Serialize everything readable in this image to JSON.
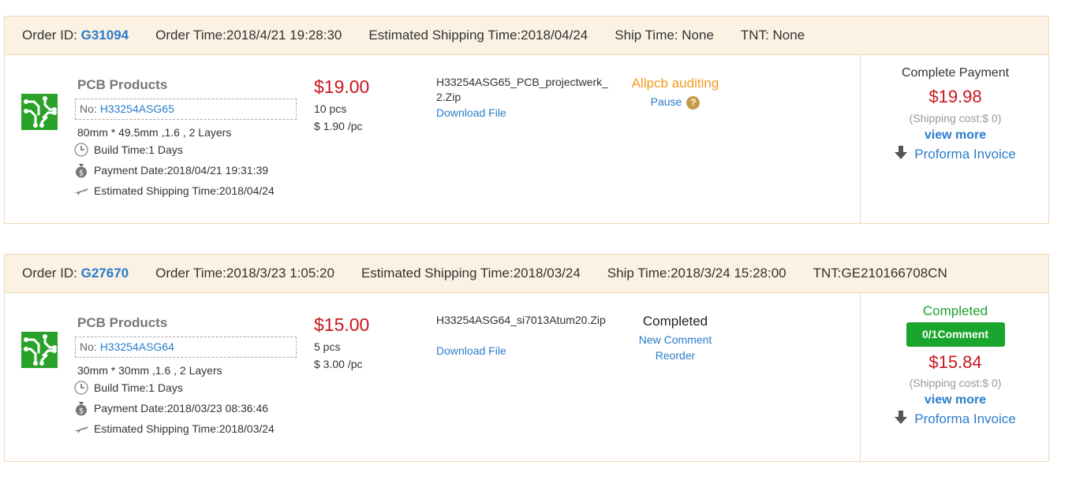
{
  "orders": [
    {
      "header": {
        "order_id_label": "Order ID: ",
        "order_id": "G31094",
        "order_time": "Order Time:2018/4/21 19:28:30",
        "est_shipping": "Estimated Shipping Time:2018/04/24",
        "ship_time": "Ship Time: None",
        "tnt": "TNT: None"
      },
      "product": {
        "title": "PCB Products",
        "no_label": "No: ",
        "no": "H33254ASG65",
        "spec": "80mm * 49.5mm ,1.6 , 2 Layers",
        "build_time": "Build Time:1 Days",
        "payment_date": "Payment Date:2018/04/21 19:31:39",
        "est_shipping": "Estimated Shipping Time:2018/04/24"
      },
      "price": "$19.00",
      "qty": "10 pcs",
      "unit_price": "$ 1.90 /pc",
      "file": {
        "name": "H33254ASG65_PCB_projectwerk_2.Zip",
        "download": "Download File"
      },
      "status": {
        "main": "Allpcb auditing",
        "main_color": "#f39a1e",
        "actions": [
          "Pause"
        ]
      },
      "payment": {
        "title": "Complete Payment",
        "amount": "$19.98",
        "shipping_cost": "(Shipping cost:$ 0)",
        "view_more": "view more",
        "invoice": "Proforma Invoice"
      }
    },
    {
      "header": {
        "order_id_label": "Order ID: ",
        "order_id": "G27670",
        "order_time": "Order Time:2018/3/23 1:05:20",
        "est_shipping": "Estimated Shipping Time:2018/03/24",
        "ship_time": "Ship Time:2018/3/24 15:28:00",
        "tnt": "TNT:GE210166708CN"
      },
      "product": {
        "title": "PCB Products",
        "no_label": "No: ",
        "no": "H33254ASG64",
        "spec": "30mm * 30mm ,1.6 , 2 Layers",
        "build_time": "Build Time:1 Days",
        "payment_date": "Payment Date:2018/03/23 08:36:46",
        "est_shipping": "Estimated Shipping Time:2018/03/24"
      },
      "price": "$15.00",
      "qty": "5 pcs",
      "unit_price": "$ 3.00 /pc",
      "file": {
        "name": "H33254ASG64_si7013Atum20.Zip",
        "download": "Download File"
      },
      "status": {
        "main": "Completed",
        "main_color": "#222222",
        "actions": [
          "New Comment",
          "Reorder"
        ]
      },
      "payment": {
        "title": "Completed",
        "comment_button": "0/1Comment",
        "amount": "$15.84",
        "shipping_cost": "(Shipping cost:$ 0)",
        "view_more": "view more",
        "invoice": "Proforma Invoice"
      }
    }
  ],
  "colors": {
    "link": "#2a7ccc",
    "price": "#c8161d",
    "header_bg": "#fbf2e3",
    "border": "#f0d9b5",
    "success": "#1aa52c"
  }
}
